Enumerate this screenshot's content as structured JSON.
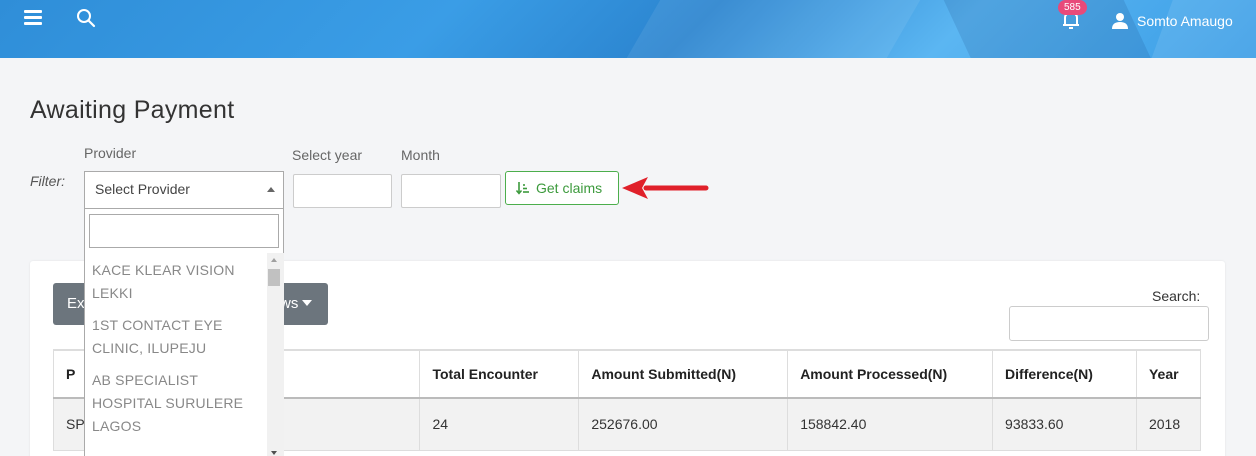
{
  "header": {
    "notification_count": "585",
    "user_name": "Somto Amaugo",
    "icons": [
      "menu-icon",
      "search-icon",
      "bell-icon",
      "user-icon"
    ]
  },
  "page": {
    "title": "Awaiting Payment"
  },
  "filter": {
    "label": "Filter:",
    "provider_label": "Provider",
    "provider_value": "Select Provider",
    "year_label": "Select year",
    "year_value": "",
    "month_label": "Month",
    "month_value": "",
    "get_claims_label": "Get claims"
  },
  "provider_dropdown": {
    "search_value": "",
    "options": [
      "KACE KLEAR VISION LEKKI",
      "1ST CONTACT EYE CLINIC, ILUPEJU",
      "AB SPECIALIST HOSPITAL SURULERE LAGOS"
    ]
  },
  "toolbar": {
    "export_label": "Ex",
    "rows_label": "ws",
    "search_label": "Search:",
    "search_value": ""
  },
  "table": {
    "headers": [
      "P",
      "Total Encounter",
      "Amount Submitted(N)",
      "Amount Processed(N)",
      "Difference(N)",
      "Year"
    ],
    "rows": [
      [
        "SP",
        "24",
        "252676.00",
        "158842.40",
        "93833.60",
        "2018"
      ]
    ]
  },
  "colors": {
    "header_blue": "#3a9de6",
    "success_green": "#3c9a3c",
    "badge_pink": "#e84a7a",
    "arrow_red": "#e0202a",
    "button_gray": "#6c757d"
  }
}
